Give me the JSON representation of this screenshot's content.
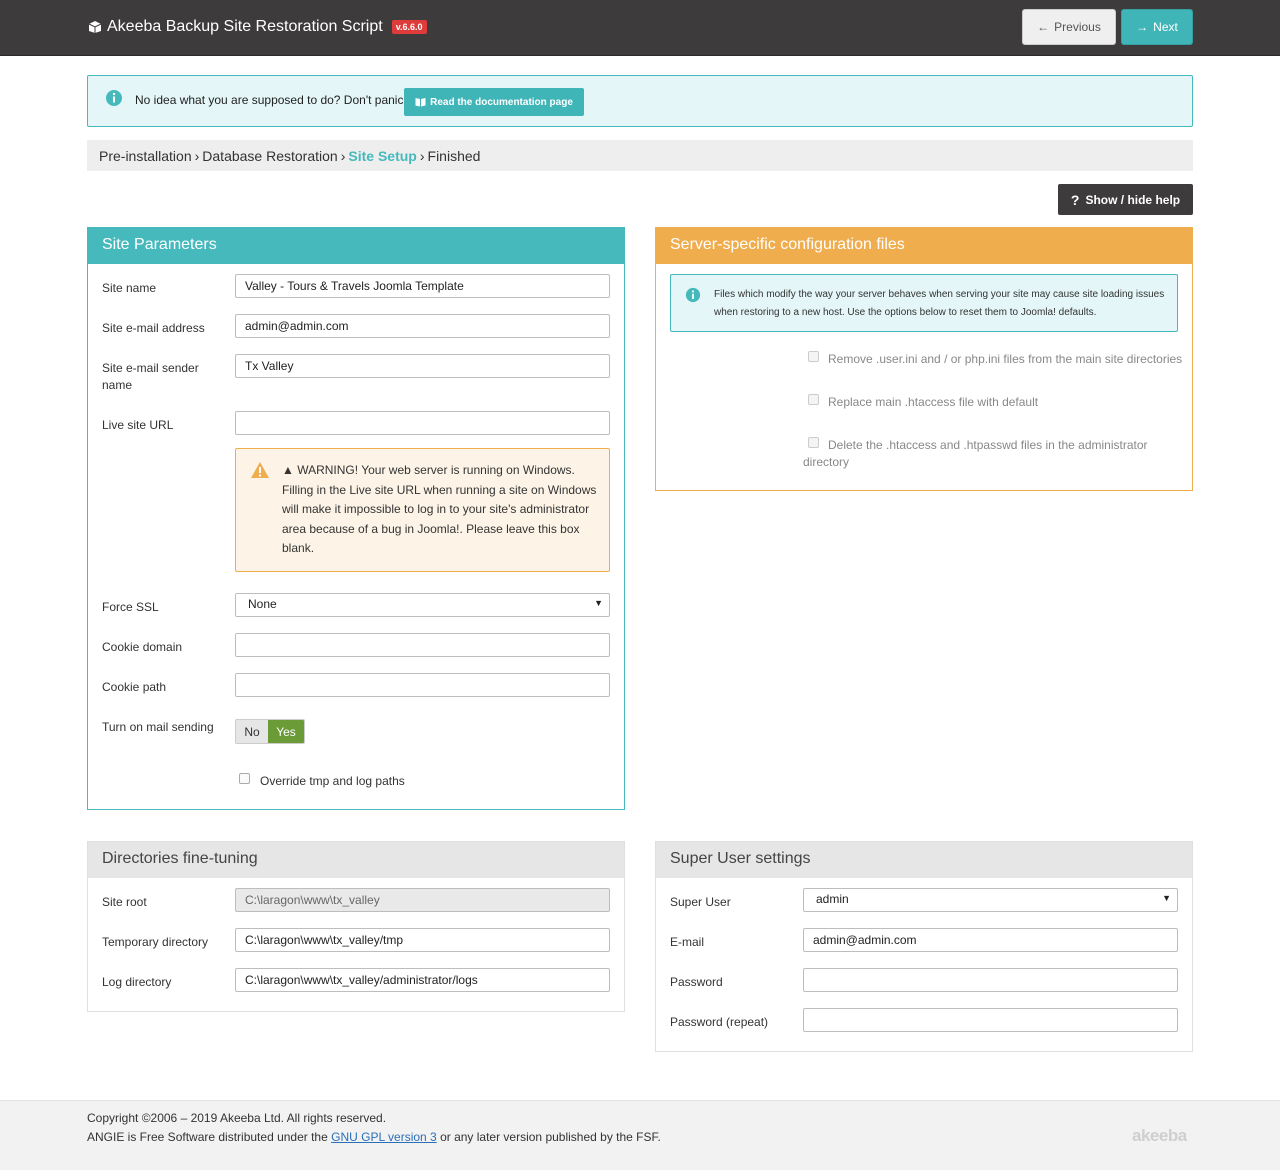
{
  "header": {
    "title": "Akeeba Backup Site Restoration Script",
    "version": "v.6.6.0",
    "previous_label": "Previous",
    "next_label": "Next"
  },
  "info_banner": {
    "message": "No idea what you are supposed to do? Don't panic!",
    "docs_button": "Read the documentation page"
  },
  "breadcrumb": {
    "steps": [
      "Pre-installation",
      "Database Restoration",
      "Site Setup",
      "Finished"
    ],
    "active_index": 2
  },
  "help_button": "Show / hide help",
  "site_parameters": {
    "title": "Site Parameters",
    "site_name_label": "Site name",
    "site_name_value": "Valley - Tours & Travels Joomla Template",
    "email_label": "Site e-mail address",
    "email_value": "admin@admin.com",
    "sender_label": "Site e-mail sender name",
    "sender_value": "Tx Valley",
    "live_url_label": "Live site URL",
    "live_url_value": "",
    "warning": "▲ WARNING! Your web server is running on Windows. Filling in the Live site URL when running a site on Windows will make it impossible to log in to your site's administrator area because of a bug in Joomla!. Please leave this box blank.",
    "force_ssl_label": "Force SSL",
    "force_ssl_value": "None",
    "cookie_domain_label": "Cookie domain",
    "cookie_domain_value": "",
    "cookie_path_label": "Cookie path",
    "cookie_path_value": "",
    "mail_label": "Turn on mail sending",
    "mail_no": "No",
    "mail_yes": "Yes",
    "override_label": "Override tmp and log paths"
  },
  "server_config": {
    "title": "Server-specific configuration files",
    "info": "Files which modify the way your server behaves when serving your site may cause site loading issues when restoring to a new host. Use the options below to reset them to Joomla! defaults.",
    "option1": "Remove .user.ini and / or php.ini files from the main site directories",
    "option2": "Replace main .htaccess file with default",
    "option3_line1": "Delete the .htaccess and .htpasswd files in the administrator",
    "option3_line2": "directory"
  },
  "directories": {
    "title": "Directories fine-tuning",
    "site_root_label": "Site root",
    "site_root_value": "C:\\laragon\\www\\tx_valley",
    "tmp_label": "Temporary directory",
    "tmp_value": "C:\\laragon\\www\\tx_valley/tmp",
    "log_label": "Log directory",
    "log_value": "C:\\laragon\\www\\tx_valley/administrator/logs"
  },
  "super_user": {
    "title": "Super User settings",
    "user_label": "Super User",
    "user_value": "admin",
    "email_label": "E-mail",
    "email_value": "admin@admin.com",
    "password_label": "Password",
    "password_value": "",
    "password_repeat_label": "Password (repeat)",
    "password_repeat_value": ""
  },
  "footer": {
    "copyright": "Copyright ©2006 – 2019 Akeeba Ltd. All rights reserved.",
    "license_prefix": "ANGIE is Free Software distributed under the",
    "license_link": "GNU GPL version 3",
    "license_suffix": "or any later version published by the FSF.",
    "logo_text": "akeeba"
  },
  "colors": {
    "teal": "#46b9bd",
    "orange": "#f0ad4e",
    "dark": "#3d3b3b",
    "green": "#6b9b37",
    "red_badge": "#e03b3b"
  }
}
